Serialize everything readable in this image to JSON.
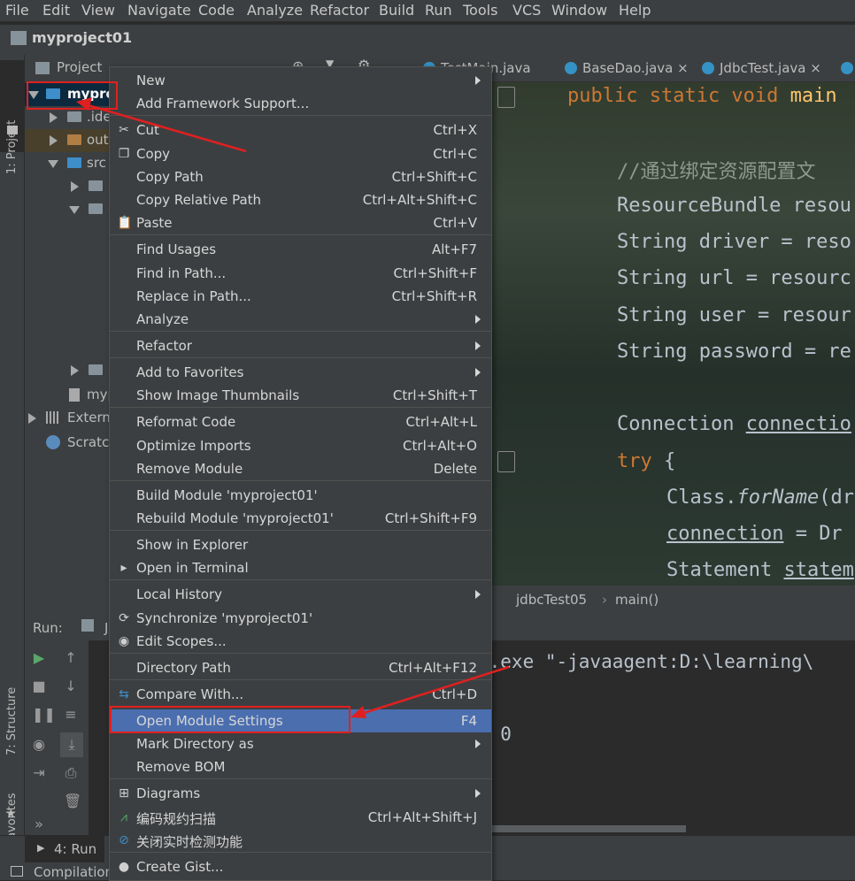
{
  "menubar": [
    "File",
    "Edit",
    "View",
    "Navigate",
    "Code",
    "Analyze",
    "Refactor",
    "Build",
    "Run",
    "Tools",
    "VCS",
    "Window",
    "Help"
  ],
  "project_name": "myproject01",
  "stripe": {
    "project_tab": "1: Project",
    "structure_tab": "7: Structure",
    "favorites_tab": "2: Favorites"
  },
  "project_panel": {
    "title": "Project",
    "tree": [
      {
        "label": "myproj"
      },
      {
        "label": ".ide"
      },
      {
        "label": "out"
      },
      {
        "label": "src"
      },
      {
        "label": "c"
      },
      {
        "label": "c"
      },
      {
        "label": "c"
      },
      {
        "label": "myp"
      },
      {
        "label": "Extern"
      },
      {
        "label": "Scratch"
      }
    ]
  },
  "tabs": [
    "TestMain.java",
    "BaseDao.java",
    "JdbcTest.java"
  ],
  "code": {
    "l1_kw": "public static void ",
    "l1_fn": "main",
    "l2": "//通过绑定资源配置文",
    "l3": "ResourceBundle resou",
    "l4": "String driver = reso",
    "l5": "String url = resourc",
    "l6": "String user = resour",
    "l7": "String password = re",
    "l8a": "Connection ",
    "l8b": "connectio",
    "l9a": "try",
    "l9b": " {",
    "l10a": "Class.",
    "l10b": "forName",
    "l10c": "(dr",
    "l11a": "connection",
    "l11b": " = Dr",
    "l12a": "Statement ",
    "l12b": "statem"
  },
  "breadcrumb": {
    "cls": "jdbcTest05",
    "method": "main()"
  },
  "run": {
    "label": "Run:",
    "tab": "J",
    "console1": "a.exe \"-javaagent:D:\\learning\\",
    "console2": "e 0"
  },
  "bottom": {
    "run_tab": "4: Run",
    "status": "Compilation"
  },
  "menu": [
    {
      "label": "New",
      "shortcut": "",
      "submenu": true,
      "icon": ""
    },
    {
      "label": "Add Framework Support...",
      "shortcut": "",
      "submenu": false,
      "icon": ""
    },
    {
      "label": "Cut",
      "shortcut": "Ctrl+X",
      "submenu": false,
      "icon": "scissors-icon"
    },
    {
      "label": "Copy",
      "shortcut": "Ctrl+C",
      "submenu": false,
      "icon": "copy-icon"
    },
    {
      "label": "Copy Path",
      "shortcut": "Ctrl+Shift+C",
      "submenu": false,
      "icon": ""
    },
    {
      "label": "Copy Relative Path",
      "shortcut": "Ctrl+Alt+Shift+C",
      "submenu": false,
      "icon": ""
    },
    {
      "label": "Paste",
      "shortcut": "Ctrl+V",
      "submenu": false,
      "icon": "paste-icon"
    },
    {
      "label": "Find Usages",
      "shortcut": "Alt+F7",
      "submenu": false,
      "icon": ""
    },
    {
      "label": "Find in Path...",
      "shortcut": "Ctrl+Shift+F",
      "submenu": false,
      "icon": ""
    },
    {
      "label": "Replace in Path...",
      "shortcut": "Ctrl+Shift+R",
      "submenu": false,
      "icon": ""
    },
    {
      "label": "Analyze",
      "shortcut": "",
      "submenu": true,
      "icon": ""
    },
    {
      "label": "Refactor",
      "shortcut": "",
      "submenu": true,
      "icon": ""
    },
    {
      "label": "Add to Favorites",
      "shortcut": "",
      "submenu": true,
      "icon": ""
    },
    {
      "label": "Show Image Thumbnails",
      "shortcut": "Ctrl+Shift+T",
      "submenu": false,
      "icon": ""
    },
    {
      "label": "Reformat Code",
      "shortcut": "Ctrl+Alt+L",
      "submenu": false,
      "icon": ""
    },
    {
      "label": "Optimize Imports",
      "shortcut": "Ctrl+Alt+O",
      "submenu": false,
      "icon": ""
    },
    {
      "label": "Remove Module",
      "shortcut": "Delete",
      "submenu": false,
      "icon": ""
    },
    {
      "label": "Build Module 'myproject01'",
      "shortcut": "",
      "submenu": false,
      "icon": ""
    },
    {
      "label": "Rebuild Module 'myproject01'",
      "shortcut": "Ctrl+Shift+F9",
      "submenu": false,
      "icon": ""
    },
    {
      "label": "Show in Explorer",
      "shortcut": "",
      "submenu": false,
      "icon": ""
    },
    {
      "label": "Open in Terminal",
      "shortcut": "",
      "submenu": false,
      "icon": "terminal-icon"
    },
    {
      "label": "Local History",
      "shortcut": "",
      "submenu": true,
      "icon": ""
    },
    {
      "label": "Synchronize 'myproject01'",
      "shortcut": "",
      "submenu": false,
      "icon": "sync-icon"
    },
    {
      "label": "Edit Scopes...",
      "shortcut": "",
      "submenu": false,
      "icon": "scope-icon"
    },
    {
      "label": "Directory Path",
      "shortcut": "Ctrl+Alt+F12",
      "submenu": false,
      "icon": ""
    },
    {
      "label": "Compare With...",
      "shortcut": "Ctrl+D",
      "submenu": false,
      "icon": "compare-icon"
    },
    {
      "label": "Open Module Settings",
      "shortcut": "F4",
      "submenu": false,
      "icon": ""
    },
    {
      "label": "Mark Directory as",
      "shortcut": "",
      "submenu": true,
      "icon": ""
    },
    {
      "label": "Remove BOM",
      "shortcut": "",
      "submenu": false,
      "icon": ""
    },
    {
      "label": "Diagrams",
      "shortcut": "",
      "submenu": true,
      "icon": "diagram-icon"
    },
    {
      "label": "编码规约扫描",
      "shortcut": "Ctrl+Alt+Shift+J",
      "submenu": false,
      "icon": "scan-icon"
    },
    {
      "label": "关闭实时检测功能",
      "shortcut": "",
      "submenu": false,
      "icon": "disable-icon"
    },
    {
      "label": "Create Gist...",
      "shortcut": "",
      "submenu": false,
      "icon": "github-icon"
    }
  ],
  "colors": {
    "selected": "#4b6eaf",
    "annotation": "#e02020",
    "keyword": "#cc7832",
    "function": "#ffc66d"
  }
}
